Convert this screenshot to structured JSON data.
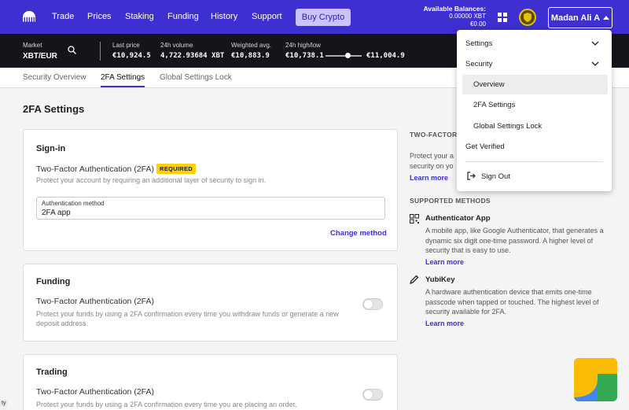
{
  "nav": {
    "items": [
      "Trade",
      "Prices",
      "Staking",
      "Funding",
      "History",
      "Support"
    ],
    "buy_label": "Buy Crypto",
    "balances_label": "Available Balances:",
    "balance_xbt": "0.00000 XBT",
    "balance_eur": "€0.00",
    "user_label": "Madan Ali A"
  },
  "ticker": {
    "market_label": "Market",
    "pair": "XBT/EUR",
    "last_price_label": "Last price",
    "last_price": "€10,924.5",
    "volume_label": "24h volume",
    "volume": "4,722.93684 XBT",
    "weighted_label": "Weighted avg.",
    "weighted": "€10,883.9",
    "highlow_label": "24h high/low",
    "low": "€10,738.1",
    "high": "€11,004.9",
    "range_position": 0.63
  },
  "tabs": [
    "Security Overview",
    "2FA Settings",
    "Global Settings Lock"
  ],
  "page_title": "2FA Settings",
  "signin": {
    "title": "Sign-in",
    "sub": "Two-Factor Authentication (2FA)",
    "required": "REQUIRED",
    "desc": "Protect your account by requiring an additional layer of security to sign in.",
    "method_label": "Authentication method",
    "method_value": "2FA app",
    "change_label": "Change method"
  },
  "funding": {
    "title": "Funding",
    "sub": "Two-Factor Authentication (2FA)",
    "desc": "Protect your funds by using a 2FA confirmation every time you withdraw funds or generate a new deposit address."
  },
  "trading": {
    "title": "Trading",
    "sub": "Two-Factor Authentication (2FA)",
    "desc": "Protect your funds by using a 2FA confirmation every time you are placing an order."
  },
  "right_panel": {
    "heading": "TWO-FACTOR",
    "intro_line1": "Protect your a",
    "intro_line2": "security on yo",
    "learn_more": "Learn more",
    "supported_heading": "SUPPORTED METHODS",
    "auth_title": "Authenticator App",
    "auth_desc": "A mobile app, like Google Authenticator, that generates a dynamic six digit one-time password. A higher level of security that is easy to use.",
    "yubi_title": "YubiKey",
    "yubi_desc": "A hardware authentication device that emits one-time passcode when tapped or touched. The highest level of security available for 2FA."
  },
  "dropdown": {
    "settings": "Settings",
    "security": "Security",
    "overview": "Overview",
    "twofa": "2FA Settings",
    "global_lock": "Global Settings Lock",
    "verified": "Get Verified",
    "sign_out": "Sign Out"
  },
  "left_tag": "ty",
  "colors": {
    "accent": "#3d2fd0",
    "required": "#ffd200",
    "ticker_bg": "#14141a"
  }
}
